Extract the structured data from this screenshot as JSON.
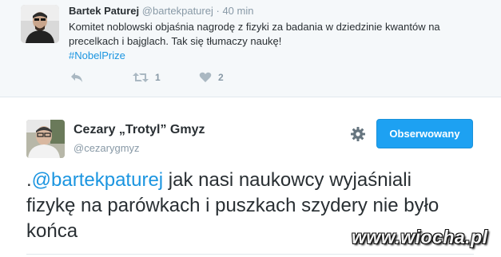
{
  "tweet_reply": {
    "author_name": "Bartek Paturej",
    "author_handle": "@bartekpaturej",
    "separator": "·",
    "time": "40 min",
    "text": "Komitet noblowski objaśnia nagrodę z fizyki za badania w dziedzinie kwantów na precelkach i bajglach. Tak się tłumaczy naukę!",
    "hashtag": "#NobelPrize",
    "actions": {
      "reply_icon": "reply-icon",
      "retweet_icon": "retweet-icon",
      "retweet_count": "1",
      "like_icon": "heart-icon",
      "like_count": "2"
    }
  },
  "tweet_main": {
    "author_name": "Cezary „Trotyl” Gmyz",
    "author_handle": "@cezarygmyz",
    "settings_icon": "gear-icon",
    "follow_button_label": "Obserwowany",
    "mention_prefix": ".",
    "mention": "@bartekpaturej",
    "text": " jak nasi naukowcy wyjaśniali fizykę na parówkach i puszkach szydery nie było końca"
  },
  "watermark": "www.wiocha.pl",
  "colors": {
    "accent": "#1da1f2",
    "link": "#1b95e0",
    "muted": "#8899a6",
    "text": "#292f33",
    "reply_background": "#f5f8fa"
  }
}
